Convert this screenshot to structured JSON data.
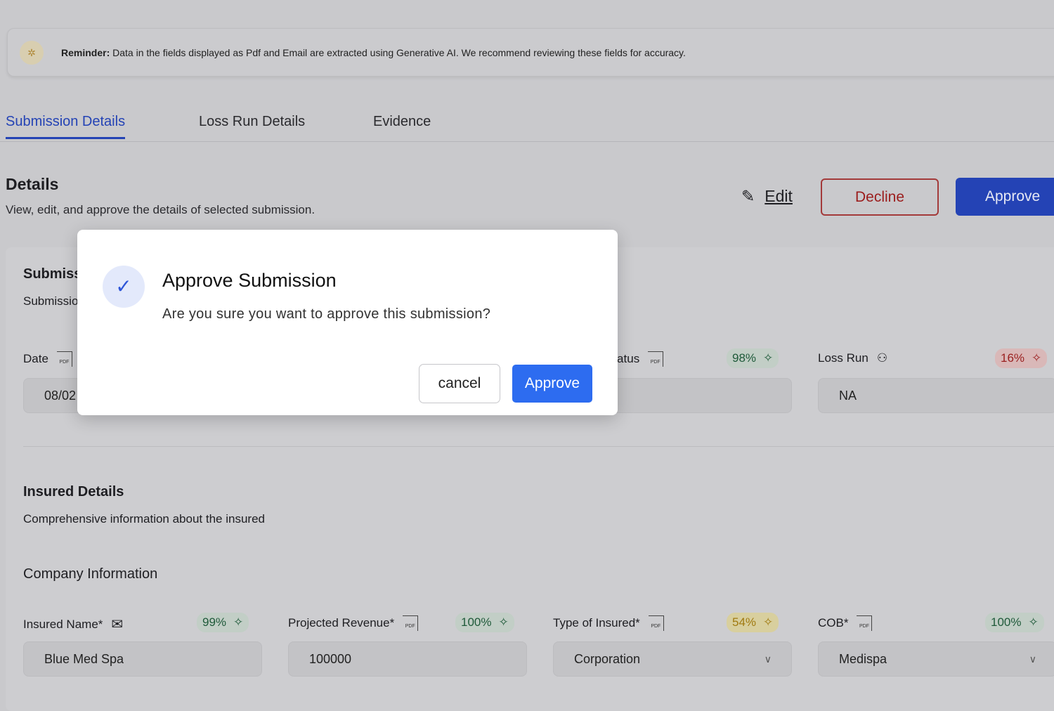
{
  "banner": {
    "bold": "Reminder:",
    "text": " Data in the fields displayed as Pdf and Email are extracted using Generative AI. We recommend reviewing these fields for accuracy."
  },
  "tabs": [
    "Submission Details",
    "Loss Run Details",
    "Evidence"
  ],
  "details": {
    "title": "Details",
    "subtitle": "View, edit, and approve the details of selected submission.",
    "edit": "Edit",
    "decline": "Decline",
    "approve": "Approve"
  },
  "submission": {
    "title": "Submission",
    "subtitle": "Submission",
    "fields": [
      {
        "label": "Date",
        "value": "08/02"
      },
      {
        "label": "Status",
        "confidence": "98%",
        "value": ""
      },
      {
        "label": "Loss Run",
        "confidence": "16%",
        "value": "NA"
      }
    ]
  },
  "insured": {
    "title": "Insured Details",
    "subtitle": "Comprehensive information about the insured",
    "group": "Company Information",
    "fields": [
      {
        "label": "Insured Name*",
        "confidence": "99%",
        "value": "Blue Med Spa"
      },
      {
        "label": "Projected Revenue*",
        "confidence": "100%",
        "value": "100000"
      },
      {
        "label": "Type of Insured*",
        "confidence": "54%",
        "value": "Corporation"
      },
      {
        "label": "COB*",
        "confidence": "100%",
        "value": "Medispa"
      }
    ]
  },
  "modal": {
    "title": "Approve Submission",
    "text": "Are you sure you want to approve this submission?",
    "cancel": "cancel",
    "approve": "Approve"
  },
  "colors": {
    "accent": "#2443b5",
    "modal_button": "#2d6cf0",
    "decline": "#9b1c1c"
  }
}
